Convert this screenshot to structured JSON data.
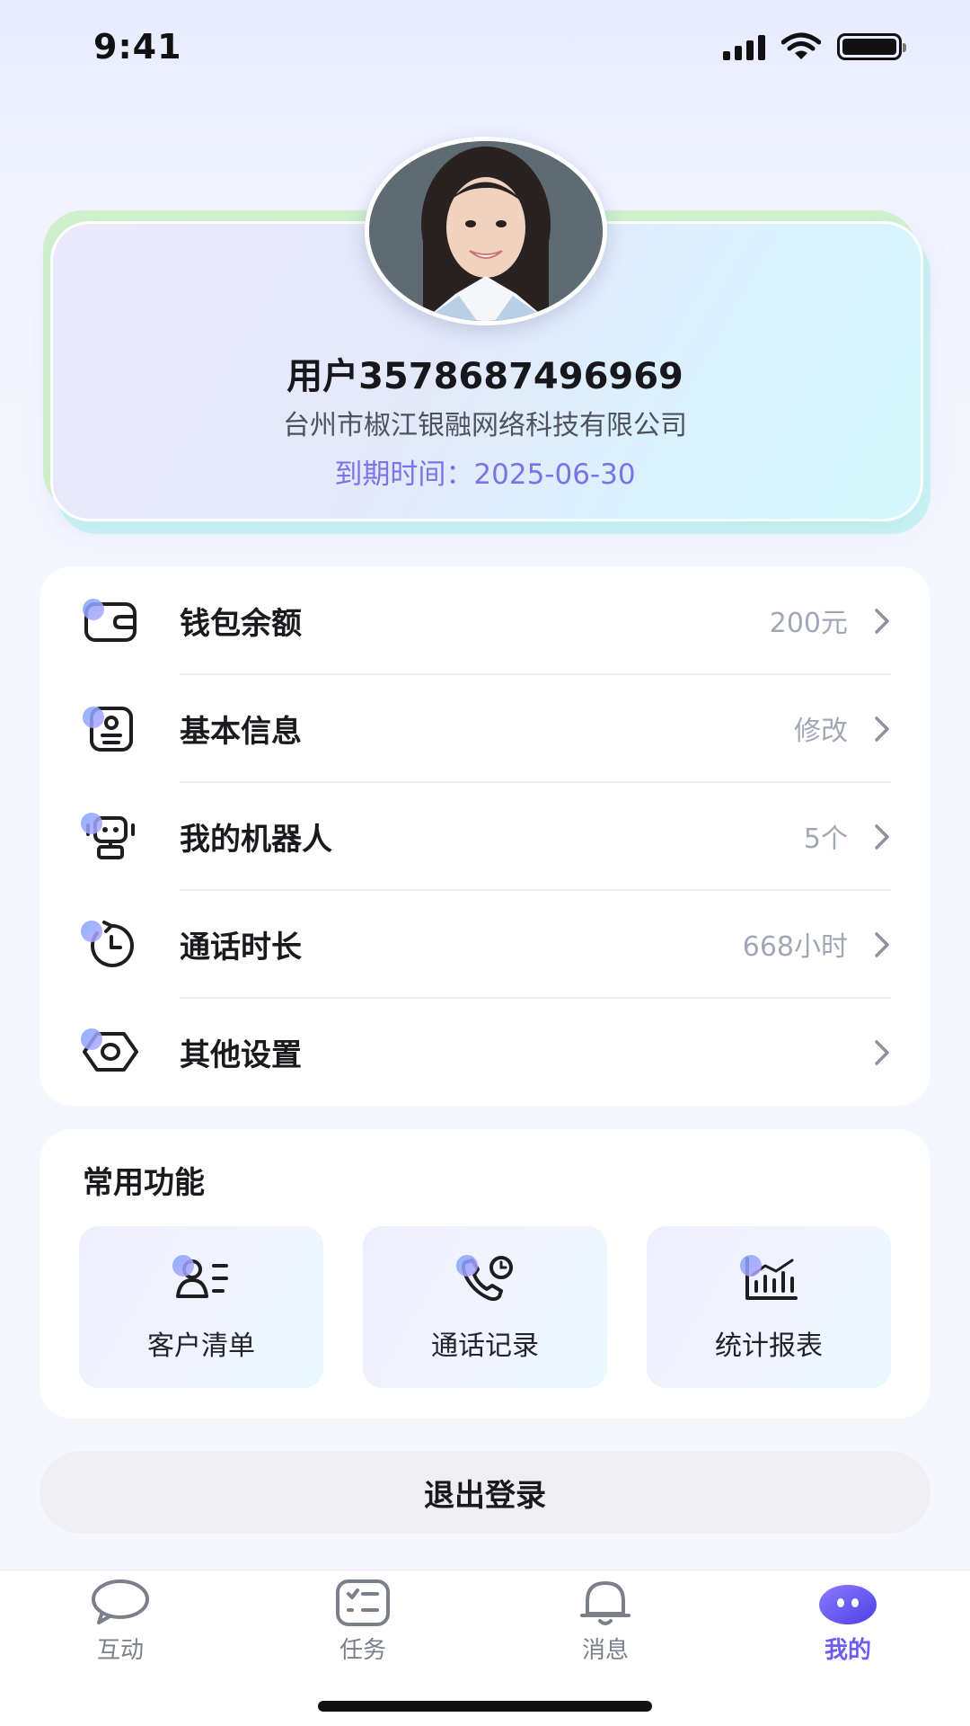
{
  "status_bar": {
    "time": "9:41"
  },
  "profile": {
    "username": "用户3578687496969",
    "company": "台州市椒江银融网络科技有限公司",
    "expiry": "到期时间：2025-06-30"
  },
  "menu": [
    {
      "icon": "wallet-icon",
      "label": "钱包余额",
      "value": "200元"
    },
    {
      "icon": "id-card-icon",
      "label": "基本信息",
      "value": "修改"
    },
    {
      "icon": "robot-icon",
      "label": "我的机器人",
      "value": "5个"
    },
    {
      "icon": "timer-icon",
      "label": "通话时长",
      "value": "668小时"
    },
    {
      "icon": "settings-icon",
      "label": "其他设置",
      "value": ""
    }
  ],
  "functions": {
    "title": "常用功能",
    "items": [
      {
        "icon": "customers-icon",
        "label": "客户清单"
      },
      {
        "icon": "call-log-icon",
        "label": "通话记录"
      },
      {
        "icon": "stats-chart-icon",
        "label": "统计报表"
      }
    ]
  },
  "logout": {
    "label": "退出登录"
  },
  "tabbar": {
    "items": [
      {
        "icon": "chat-bubble-icon",
        "label": "互动"
      },
      {
        "icon": "task-list-icon",
        "label": "任务"
      },
      {
        "icon": "bell-icon",
        "label": "消息"
      },
      {
        "icon": "mine-face-icon",
        "label": "我的"
      }
    ],
    "active_color": "#6f5cf2"
  }
}
